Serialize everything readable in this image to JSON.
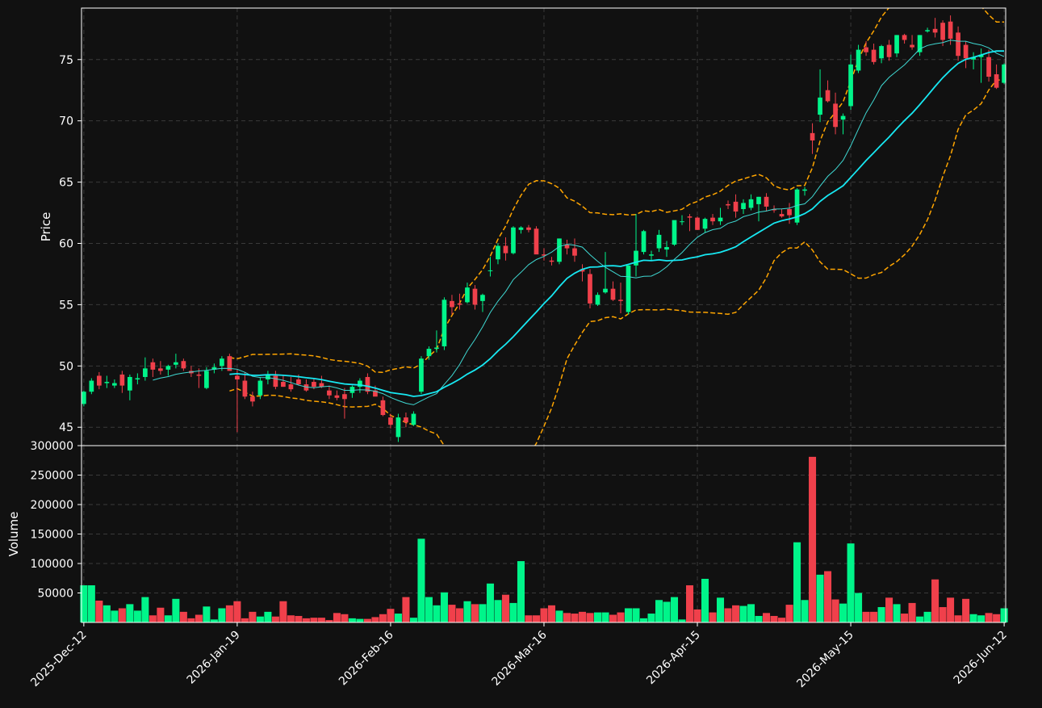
{
  "colors": {
    "background": "#111111",
    "frame": "#ffffff",
    "grid": "#3a3a3a",
    "text": "#ffffff",
    "up": "#00f58a",
    "down": "#f0404b",
    "ma_fast": "#3fd8d2",
    "ma_slow": "#17e8f2",
    "bands": "#ffa500"
  },
  "chart_data": {
    "type": "candlestick",
    "price_panel": {
      "ylabel": "Price",
      "ylim": [
        43.5,
        79.2
      ],
      "yticks": [
        45,
        50,
        55,
        60,
        65,
        70,
        75
      ],
      "grid": true
    },
    "volume_panel": {
      "ylabel": "Volume",
      "ylim": [
        0,
        300000
      ],
      "yticks": [
        50000,
        100000,
        150000,
        200000,
        250000,
        300000
      ],
      "grid": true
    },
    "xlim": [
      -0.3,
      120.2
    ],
    "xticks": [
      {
        "i": 0,
        "label": "2025-Dec-12"
      },
      {
        "i": 20,
        "label": "2026-Jan-19"
      },
      {
        "i": 40,
        "label": "2026-Feb-16"
      },
      {
        "i": 60,
        "label": "2026-Mar-16"
      },
      {
        "i": 80,
        "label": "2026-Apr-15"
      },
      {
        "i": 100,
        "label": "2026-May-15"
      },
      {
        "i": 120,
        "label": "2026-Jun-12"
      }
    ],
    "ohlc": [
      [
        46.9,
        48.0,
        46.7,
        47.9
      ],
      [
        47.9,
        49.0,
        47.7,
        48.8
      ],
      [
        49.2,
        49.5,
        48.1,
        48.4
      ],
      [
        48.6,
        49.2,
        48.2,
        48.7
      ],
      [
        48.4,
        48.9,
        48.2,
        48.6
      ],
      [
        49.3,
        49.6,
        47.8,
        48.4
      ],
      [
        48.0,
        49.3,
        47.2,
        49.1
      ],
      [
        48.9,
        49.4,
        48.5,
        49.0
      ],
      [
        49.1,
        50.7,
        48.8,
        49.8
      ],
      [
        50.3,
        50.6,
        49.1,
        49.7
      ],
      [
        49.8,
        50.4,
        49.3,
        49.6
      ],
      [
        49.7,
        50.1,
        49.2,
        50.0
      ],
      [
        50.1,
        51.0,
        49.8,
        50.3
      ],
      [
        50.4,
        50.6,
        49.6,
        49.8
      ],
      [
        49.6,
        50.0,
        49.1,
        49.4
      ],
      [
        49.3,
        49.8,
        48.2,
        49.2
      ],
      [
        48.2,
        49.9,
        48.1,
        49.6
      ],
      [
        49.7,
        50.2,
        49.4,
        49.9
      ],
      [
        50.0,
        50.8,
        49.6,
        50.6
      ],
      [
        50.8,
        51.0,
        49.8,
        49.6
      ],
      [
        49.2,
        49.7,
        44.6,
        48.9
      ],
      [
        48.8,
        49.5,
        47.3,
        47.5
      ],
      [
        47.5,
        47.9,
        46.7,
        47.1
      ],
      [
        47.6,
        49.1,
        47.3,
        48.8
      ],
      [
        48.9,
        49.6,
        48.5,
        49.3
      ],
      [
        49.2,
        49.6,
        48.1,
        48.3
      ],
      [
        48.7,
        49.2,
        48.3,
        48.3
      ],
      [
        48.5,
        49.1,
        47.9,
        48.1
      ],
      [
        48.9,
        49.3,
        48.4,
        48.5
      ],
      [
        48.5,
        48.9,
        47.9,
        48.0
      ],
      [
        48.7,
        49.0,
        48.1,
        48.3
      ],
      [
        48.6,
        49.2,
        48.2,
        48.3
      ],
      [
        48.0,
        48.4,
        47.3,
        47.6
      ],
      [
        47.6,
        48.0,
        47.2,
        47.4
      ],
      [
        47.7,
        48.2,
        45.7,
        47.3
      ],
      [
        47.8,
        48.4,
        47.4,
        48.3
      ],
      [
        48.3,
        49.0,
        47.8,
        48.8
      ],
      [
        49.1,
        49.4,
        47.7,
        47.9
      ],
      [
        48.0,
        48.4,
        47.6,
        47.5
      ],
      [
        47.2,
        47.5,
        45.9,
        46.0
      ],
      [
        45.8,
        46.1,
        44.9,
        45.2
      ],
      [
        44.2,
        46.1,
        43.8,
        45.8
      ],
      [
        45.8,
        46.2,
        45.0,
        45.4
      ],
      [
        45.2,
        46.3,
        45.1,
        46.1
      ],
      [
        47.9,
        50.8,
        47.7,
        50.6
      ],
      [
        50.8,
        51.6,
        50.5,
        51.4
      ],
      [
        51.4,
        52.9,
        51.1,
        51.5
      ],
      [
        51.6,
        55.6,
        51.3,
        55.4
      ],
      [
        55.3,
        55.8,
        54.2,
        54.8
      ],
      [
        55.1,
        55.9,
        54.6,
        55.0
      ],
      [
        55.2,
        56.8,
        55.1,
        56.4
      ],
      [
        56.3,
        56.6,
        54.6,
        55.0
      ],
      [
        55.3,
        55.9,
        54.4,
        55.8
      ],
      [
        57.8,
        58.9,
        57.3,
        57.8
      ],
      [
        58.7,
        60.0,
        58.3,
        59.8
      ],
      [
        59.8,
        60.5,
        58.6,
        59.2
      ],
      [
        59.2,
        61.4,
        59.1,
        61.3
      ],
      [
        61.1,
        61.4,
        60.8,
        61.3
      ],
      [
        61.3,
        61.5,
        60.9,
        61.1
      ],
      [
        61.2,
        61.4,
        59.2,
        59.1
      ],
      [
        59.1,
        59.6,
        58.6,
        59.0
      ],
      [
        58.6,
        58.9,
        58.2,
        58.5
      ],
      [
        58.5,
        60.4,
        58.3,
        60.4
      ],
      [
        59.9,
        60.3,
        59.1,
        59.6
      ],
      [
        59.6,
        60.4,
        58.5,
        59.0
      ],
      [
        57.9,
        58.3,
        56.9,
        57.7
      ],
      [
        57.5,
        57.9,
        54.7,
        55.1
      ],
      [
        55.0,
        56.0,
        54.9,
        55.8
      ],
      [
        56.0,
        59.3,
        55.9,
        56.3
      ],
      [
        56.3,
        56.9,
        55.3,
        55.4
      ],
      [
        55.4,
        56.8,
        54.3,
        55.3
      ],
      [
        54.4,
        58.2,
        54.2,
        58.2
      ],
      [
        58.2,
        62.4,
        57.3,
        59.4
      ],
      [
        59.3,
        61.1,
        59.1,
        61.0
      ],
      [
        59.0,
        59.4,
        58.6,
        59.1
      ],
      [
        59.6,
        61.1,
        59.3,
        60.7
      ],
      [
        59.5,
        60.2,
        58.9,
        59.7
      ],
      [
        59.9,
        61.4,
        59.8,
        61.9
      ],
      [
        61.8,
        62.3,
        61.5,
        61.8
      ],
      [
        62.2,
        62.4,
        61.0,
        62.1
      ],
      [
        62.1,
        62.2,
        61.1,
        61.1
      ],
      [
        61.2,
        62.1,
        60.9,
        62.0
      ],
      [
        62.1,
        62.4,
        61.5,
        61.8
      ],
      [
        61.8,
        62.9,
        61.5,
        62.1
      ],
      [
        63.2,
        63.5,
        62.8,
        63.1
      ],
      [
        63.4,
        64.0,
        62.1,
        62.6
      ],
      [
        62.8,
        63.6,
        62.4,
        63.3
      ],
      [
        62.9,
        64.0,
        62.7,
        63.6
      ],
      [
        63.2,
        63.8,
        61.8,
        63.8
      ],
      [
        63.8,
        64.1,
        62.6,
        63.0
      ],
      [
        62.8,
        63.1,
        62.5,
        62.7
      ],
      [
        62.4,
        62.8,
        62.1,
        62.2
      ],
      [
        62.8,
        63.3,
        61.6,
        62.3
      ],
      [
        61.7,
        64.5,
        61.5,
        64.4
      ],
      [
        64.3,
        64.6,
        63.9,
        64.4
      ],
      [
        69.0,
        69.8,
        67.3,
        68.4
      ],
      [
        70.5,
        74.2,
        69.9,
        71.9
      ],
      [
        72.5,
        73.3,
        71.5,
        71.6
      ],
      [
        71.4,
        72.3,
        68.9,
        69.5
      ],
      [
        70.1,
        70.6,
        68.9,
        70.4
      ],
      [
        71.2,
        75.4,
        70.9,
        74.6
      ],
      [
        74.1,
        76.2,
        73.9,
        75.8
      ],
      [
        76.0,
        76.5,
        75.3,
        75.6
      ],
      [
        75.8,
        76.3,
        74.6,
        74.8
      ],
      [
        75.1,
        76.2,
        74.7,
        76.1
      ],
      [
        76.2,
        76.6,
        74.9,
        75.2
      ],
      [
        75.5,
        77.0,
        75.2,
        77.0
      ],
      [
        77.0,
        77.1,
        76.3,
        76.6
      ],
      [
        76.2,
        77.0,
        75.8,
        76.0
      ],
      [
        75.6,
        77.0,
        75.3,
        77.0
      ],
      [
        77.3,
        77.6,
        77.2,
        77.4
      ],
      [
        77.5,
        78.4,
        76.8,
        77.2
      ],
      [
        78.0,
        78.2,
        76.1,
        76.6
      ],
      [
        78.1,
        78.6,
        76.2,
        76.7
      ],
      [
        77.2,
        77.7,
        74.9,
        75.3
      ],
      [
        76.2,
        76.5,
        74.3,
        75.1
      ],
      [
        75.0,
        75.6,
        74.2,
        75.2
      ],
      [
        75.2,
        75.9,
        73.1,
        75.4
      ],
      [
        75.2,
        75.8,
        73.2,
        73.6
      ],
      [
        73.8,
        74.6,
        72.6,
        72.7
      ],
      [
        73.1,
        74.7,
        73.0,
        74.6
      ]
    ],
    "volume": [
      63000,
      63000,
      37000,
      29000,
      20000,
      24000,
      31000,
      20000,
      43000,
      12000,
      25000,
      12000,
      40000,
      18000,
      7000,
      13000,
      27000,
      5000,
      24000,
      29000,
      36000,
      7000,
      18000,
      10000,
      18000,
      10000,
      36000,
      12000,
      11000,
      7000,
      8000,
      8000,
      4000,
      16000,
      14000,
      7000,
      6000,
      6000,
      9000,
      14000,
      23000,
      15000,
      43000,
      8000,
      142000,
      43000,
      29000,
      51000,
      30000,
      24000,
      36000,
      31000,
      31000,
      66000,
      38000,
      47000,
      33000,
      104000,
      12000,
      12000,
      24000,
      29000,
      20000,
      16000,
      15000,
      18000,
      16000,
      17000,
      17000,
      13000,
      17000,
      24000,
      24000,
      7000,
      15000,
      38000,
      35000,
      43000,
      5000,
      63000,
      22000,
      74000,
      17000,
      42000,
      24000,
      29000,
      28000,
      31000,
      11000,
      16000,
      11000,
      8000,
      30000,
      136000,
      38000,
      281000,
      81000,
      87000,
      39000,
      32000,
      134000,
      50000,
      18000,
      18000,
      26000,
      42000,
      31000,
      15000,
      33000,
      10000,
      18000,
      73000,
      26000,
      42000,
      12000,
      40000,
      14000,
      12000,
      16000,
      14000,
      24000
    ],
    "ma_fast": {
      "window": 10
    },
    "ma_slow": {
      "window": 20
    },
    "bands": {
      "window": 20,
      "k": 2.0
    }
  }
}
